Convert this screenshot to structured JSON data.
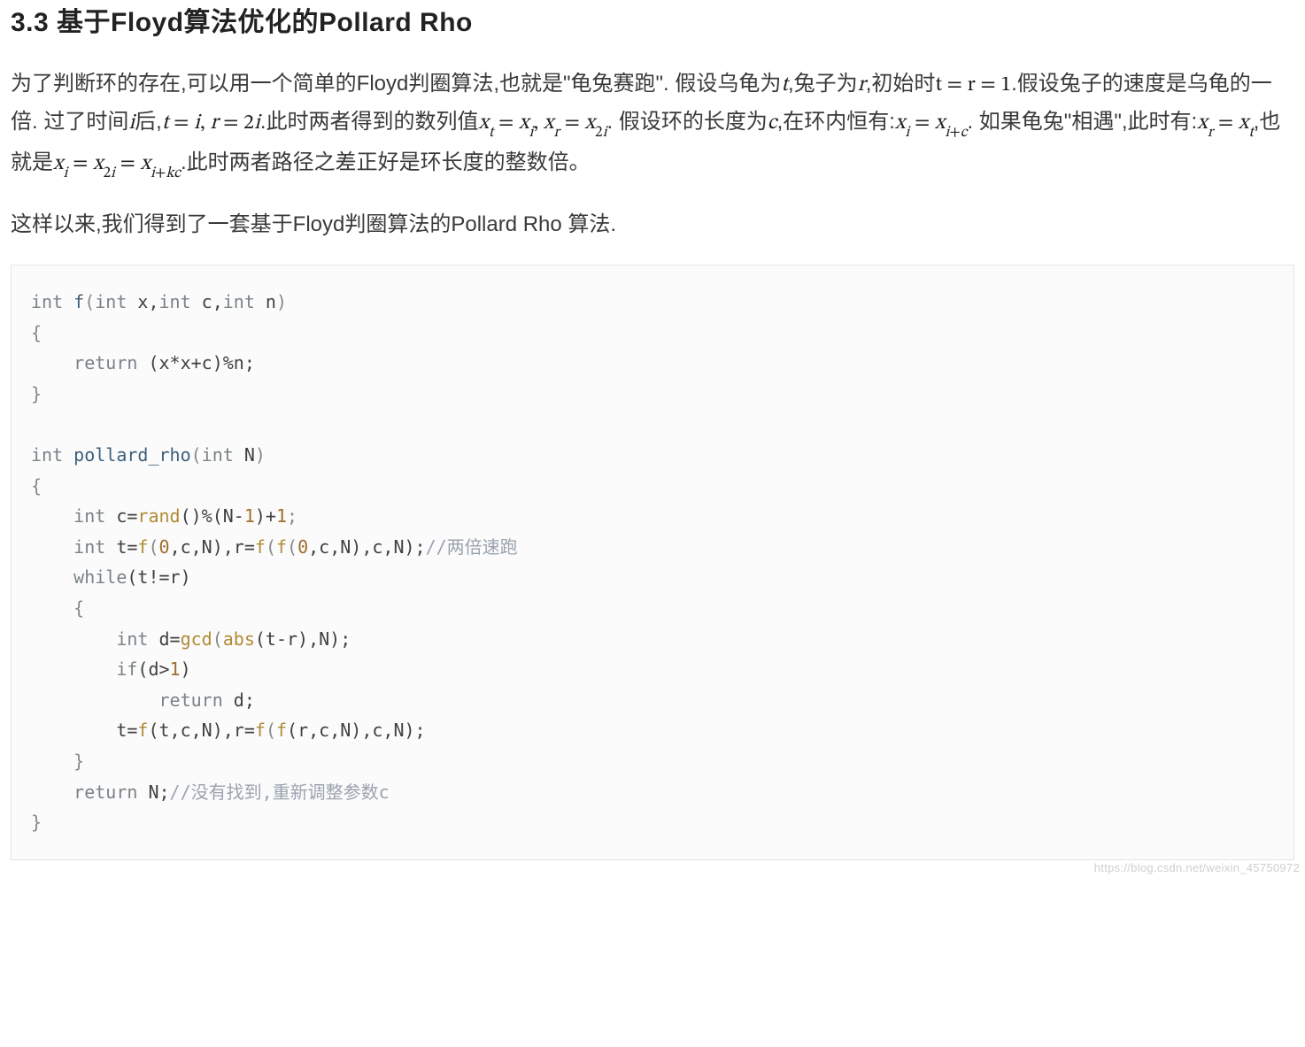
{
  "heading": "3.3 基于Floyd算法优化的Pollard Rho",
  "para1": {
    "t1": "为了判断环的存在,可以用一个简单的Floyd判圈算法,也就是\"龟兔赛跑\". 假设乌龟为",
    "m1": "t",
    "t2": ",兔子为",
    "m2": "r",
    "t3": ",初始时",
    "m3": "t = r = 1",
    "t4": ".假设兔子的速度是乌龟的一倍. 过了时间",
    "m4": "i",
    "t5": "后,",
    "m5": "t = i, r = 2i",
    "t6": ".此时两者得到的数列值",
    "m6": "x_t = x_i, x_r = x_{2i}",
    "t7": ". 假设环的长度为",
    "m7": "c",
    "t8": ",在环内恒有:",
    "m8": "x_i = x_{i+c}",
    "t9": ". 如果龟兔\"相遇\",此时有:",
    "m9": "x_r = x_t",
    "t10": ",也就是",
    "m10": "x_i = x_{2i} = x_{i+kc}",
    "t11": ".此时两者路径之差正好是环长度的整数倍。"
  },
  "para2": "这样以来,我们得到了一套基于Floyd判圈算法的Pollard Rho 算法.",
  "code": {
    "l1": {
      "kw1": "int",
      "fn": "f",
      "p1": "(",
      "kw2": "int",
      "v1": " x,",
      "kw3": "int",
      "v2": " c,",
      "kw4": "int",
      "v3": " n",
      "p2": ")"
    },
    "l2": "{",
    "l3": {
      "kw": "return",
      "expr": " (x*x+c)%n;"
    },
    "l4": "}",
    "l5": "",
    "l6": {
      "kw1": "int",
      "fn": "pollard_rho",
      "p1": "(",
      "kw2": "int",
      "v1": " N",
      "p2": ")"
    },
    "l7": "{",
    "l8": {
      "kw": "int",
      "v1": " c=",
      "call": "rand",
      "rest1": "()%(N-",
      "n1": "1",
      "rest2": ")+",
      "n2": "1",
      "semi": ";"
    },
    "l9": {
      "kw": "int",
      "v1": " t=",
      "f1": "f",
      "a1": "(",
      "n0": "0",
      "a1b": ",c,N),r=",
      "f2": "f",
      "a2": "(",
      "f3": "f",
      "a3": "(",
      "n0b": "0",
      "a3b": ",c,N),c,N);",
      "cmt": "//两倍速跑"
    },
    "l10": {
      "kw": "while",
      "cond": "(t!=r)"
    },
    "l11": "    {",
    "l12": {
      "kw": "int",
      "v1": " d=",
      "c1": "gcd",
      "p1": "(",
      "c2": "abs",
      "p2": "(t-r),N);"
    },
    "l13": {
      "kw": "if",
      "cond1": "(d>",
      "n1": "1",
      "cond2": ")"
    },
    "l14": {
      "kw": "return",
      "expr": " d;"
    },
    "l15": {
      "body": "        t=",
      "f1": "f",
      "a1": "(t,c,N),r=",
      "f2": "f",
      "a2": "(",
      "f3": "f",
      "a3": "(r,c,N),c,N);"
    },
    "l16": "    }",
    "l17": {
      "kw": "return",
      "expr": " N;",
      "cmt": "//没有找到,重新调整参数c"
    },
    "l18": "}"
  },
  "watermark": "https://blog.csdn.net/weixin_45750972"
}
